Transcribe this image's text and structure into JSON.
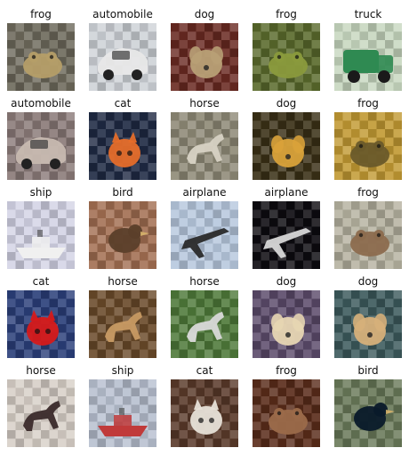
{
  "grid": [
    {
      "label": "frog",
      "icon": "frog-icon",
      "bg": "#6e6a5c",
      "fg": "#b59e68"
    },
    {
      "label": "automobile",
      "icon": "car-icon",
      "bg": "#cfd3d8",
      "fg": "#e8e8e8"
    },
    {
      "label": "dog",
      "icon": "dog-icon",
      "bg": "#6a2a22",
      "fg": "#b8a076"
    },
    {
      "label": "frog",
      "icon": "frog-icon",
      "bg": "#5a6a2c",
      "fg": "#8a9a3c"
    },
    {
      "label": "truck",
      "icon": "truck-icon",
      "bg": "#c8d8c0",
      "fg": "#2f8a52"
    },
    {
      "label": "automobile",
      "icon": "car-icon",
      "bg": "#8a7a78",
      "fg": "#c7b9b0"
    },
    {
      "label": "cat",
      "icon": "cat-icon",
      "bg": "#1f2a44",
      "fg": "#e56d2a"
    },
    {
      "label": "horse",
      "icon": "horse-icon",
      "bg": "#8f8a77",
      "fg": "#d7d2c4"
    },
    {
      "label": "dog",
      "icon": "dog-icon",
      "bg": "#3a3016",
      "fg": "#d9a23a"
    },
    {
      "label": "frog",
      "icon": "frog-icon",
      "bg": "#c29a33",
      "fg": "#6a5a2a"
    },
    {
      "label": "ship",
      "icon": "ship-icon",
      "bg": "#d4d4e6",
      "fg": "#f0f0f0"
    },
    {
      "label": "bird",
      "icon": "bird-icon",
      "bg": "#a36f52",
      "fg": "#5b3f2a"
    },
    {
      "label": "airplane",
      "icon": "airplane-icon",
      "bg": "#b7c8de",
      "fg": "#2a2a2a"
    },
    {
      "label": "airplane",
      "icon": "airplane-icon",
      "bg": "#0d0b10",
      "fg": "#d7d7d7"
    },
    {
      "label": "frog",
      "icon": "frog-icon",
      "bg": "#b6b2a0",
      "fg": "#8c6c4e"
    },
    {
      "label": "cat",
      "icon": "cat-icon",
      "bg": "#2b3f7a",
      "fg": "#d61a1a"
    },
    {
      "label": "horse",
      "icon": "horse-icon",
      "bg": "#6a4a2a",
      "fg": "#c79a63"
    },
    {
      "label": "horse",
      "icon": "horse-icon",
      "bg": "#4f7a3a",
      "fg": "#d9d9d9"
    },
    {
      "label": "dog",
      "icon": "dog-icon",
      "bg": "#5b4a6a",
      "fg": "#e7d6b3"
    },
    {
      "label": "dog",
      "icon": "dog-icon",
      "bg": "#3c5a5c",
      "fg": "#d6b07a"
    },
    {
      "label": "horse",
      "icon": "horse-icon",
      "bg": "#d8d0c8",
      "fg": "#3a2a2a"
    },
    {
      "label": "ship",
      "icon": "ship-icon",
      "bg": "#b8c0d0",
      "fg": "#c03a3a"
    },
    {
      "label": "cat",
      "icon": "cat-icon",
      "bg": "#5a3a2a",
      "fg": "#e7e2d8"
    },
    {
      "label": "frog",
      "icon": "frog-icon",
      "bg": "#5a2c1a",
      "fg": "#9b6a4a"
    },
    {
      "label": "bird",
      "icon": "bird-icon",
      "bg": "#6a7a5a",
      "fg": "#0a1a2a"
    }
  ]
}
